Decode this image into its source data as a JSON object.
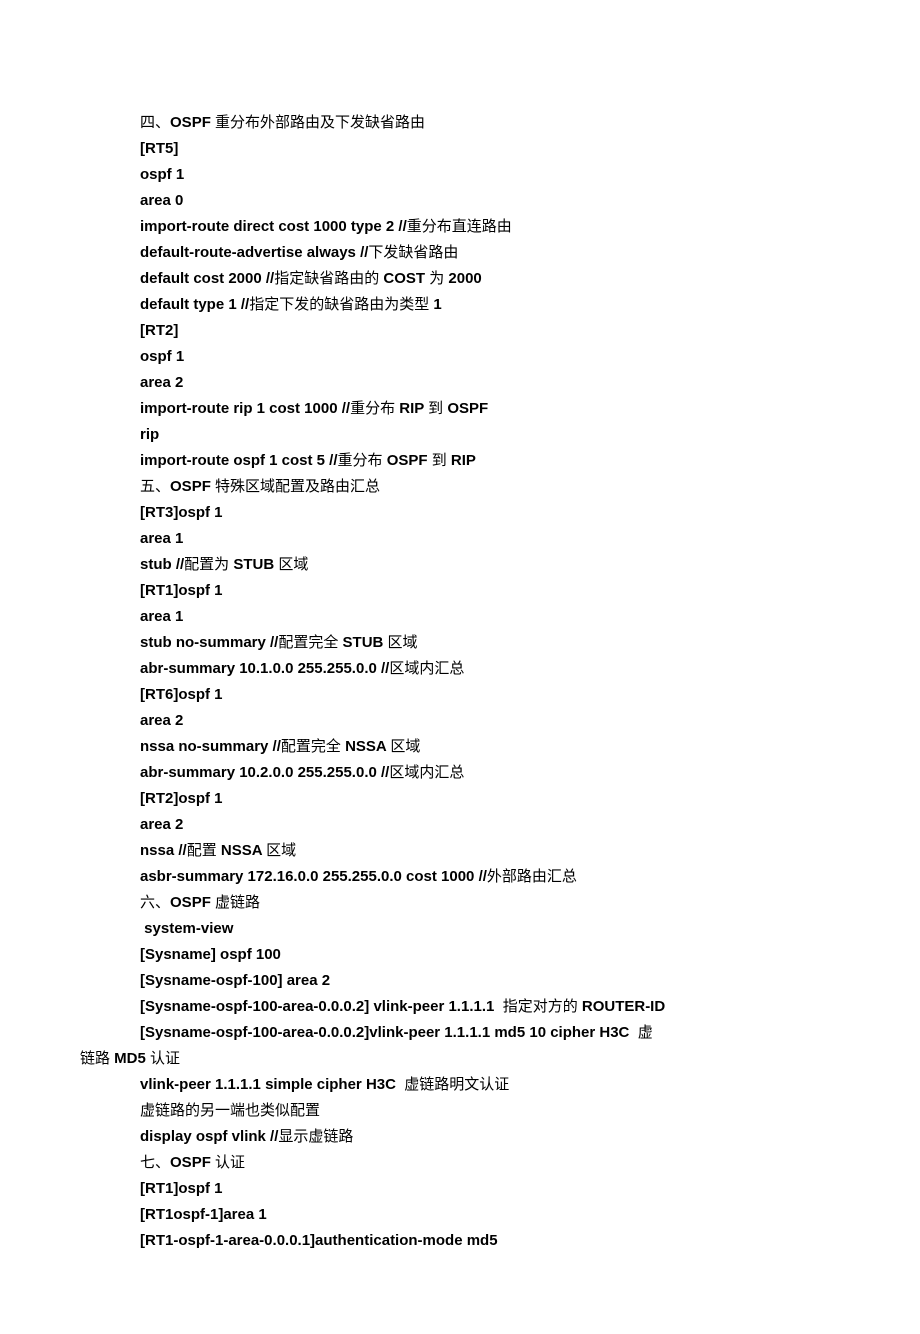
{
  "lines": [
    {
      "id": "l1",
      "segments": [
        {
          "text": "四、",
          "bold": false
        },
        {
          "text": "OSPF ",
          "bold": true
        },
        {
          "text": "重分布外部路由及下发缺省路由",
          "bold": false
        }
      ]
    },
    {
      "id": "l2",
      "segments": [
        {
          "text": "[RT5]",
          "bold": true
        }
      ]
    },
    {
      "id": "l3",
      "segments": [
        {
          "text": "ospf 1",
          "bold": true
        }
      ]
    },
    {
      "id": "l4",
      "segments": [
        {
          "text": "area 0",
          "bold": true
        }
      ]
    },
    {
      "id": "l5",
      "segments": [
        {
          "text": "import-route direct cost 1000 type 2 //",
          "bold": true
        },
        {
          "text": "重分布直连路由",
          "bold": false
        }
      ]
    },
    {
      "id": "l6",
      "segments": [
        {
          "text": "default-route-advertise always //",
          "bold": true
        },
        {
          "text": "下发缺省路由",
          "bold": false
        }
      ]
    },
    {
      "id": "l7",
      "segments": [
        {
          "text": "default cost 2000 //",
          "bold": true
        },
        {
          "text": "指定缺省路由的 ",
          "bold": false
        },
        {
          "text": "COST ",
          "bold": true
        },
        {
          "text": "为 ",
          "bold": false
        },
        {
          "text": "2000",
          "bold": true
        }
      ]
    },
    {
      "id": "l8",
      "segments": [
        {
          "text": "default type 1 //",
          "bold": true
        },
        {
          "text": "指定下发的缺省路由为类型 ",
          "bold": false
        },
        {
          "text": "1",
          "bold": true
        }
      ]
    },
    {
      "id": "l9",
      "segments": [
        {
          "text": "[RT2]",
          "bold": true
        }
      ]
    },
    {
      "id": "l10",
      "segments": [
        {
          "text": "ospf 1",
          "bold": true
        }
      ]
    },
    {
      "id": "l11",
      "segments": [
        {
          "text": "area 2",
          "bold": true
        }
      ]
    },
    {
      "id": "l12",
      "segments": [
        {
          "text": "import-route rip 1 cost 1000 //",
          "bold": true
        },
        {
          "text": "重分布 ",
          "bold": false
        },
        {
          "text": "RIP ",
          "bold": true
        },
        {
          "text": "到 ",
          "bold": false
        },
        {
          "text": "OSPF",
          "bold": true
        }
      ]
    },
    {
      "id": "l13",
      "segments": [
        {
          "text": "rip",
          "bold": true
        }
      ]
    },
    {
      "id": "l14",
      "segments": [
        {
          "text": "import-route ospf 1 cost 5 //",
          "bold": true
        },
        {
          "text": "重分布 ",
          "bold": false
        },
        {
          "text": "OSPF ",
          "bold": true
        },
        {
          "text": "到 ",
          "bold": false
        },
        {
          "text": "RIP",
          "bold": true
        }
      ]
    },
    {
      "id": "l15",
      "segments": [
        {
          "text": "五、",
          "bold": false
        },
        {
          "text": "OSPF ",
          "bold": true
        },
        {
          "text": "特殊区域配置及路由汇总",
          "bold": false
        }
      ]
    },
    {
      "id": "l16",
      "segments": [
        {
          "text": "[RT3]ospf 1",
          "bold": true
        }
      ]
    },
    {
      "id": "l17",
      "segments": [
        {
          "text": "area 1",
          "bold": true
        }
      ]
    },
    {
      "id": "l18",
      "segments": [
        {
          "text": "stub //",
          "bold": true
        },
        {
          "text": "配置为 ",
          "bold": false
        },
        {
          "text": "STUB ",
          "bold": true
        },
        {
          "text": "区域",
          "bold": false
        }
      ]
    },
    {
      "id": "l19",
      "segments": [
        {
          "text": "[RT1]ospf 1",
          "bold": true
        }
      ]
    },
    {
      "id": "l20",
      "segments": [
        {
          "text": "area 1",
          "bold": true
        }
      ]
    },
    {
      "id": "l21",
      "segments": [
        {
          "text": "stub no-summary //",
          "bold": true
        },
        {
          "text": "配置完全 ",
          "bold": false
        },
        {
          "text": "STUB ",
          "bold": true
        },
        {
          "text": "区域",
          "bold": false
        }
      ]
    },
    {
      "id": "l22",
      "segments": [
        {
          "text": "abr-summary 10.1.0.0 255.255.0.0 //",
          "bold": true
        },
        {
          "text": "区域内汇总",
          "bold": false
        }
      ]
    },
    {
      "id": "l23",
      "segments": [
        {
          "text": "[RT6]ospf 1",
          "bold": true
        }
      ]
    },
    {
      "id": "l24",
      "segments": [
        {
          "text": "area 2",
          "bold": true
        }
      ]
    },
    {
      "id": "l25",
      "segments": [
        {
          "text": "nssa no-summary //",
          "bold": true
        },
        {
          "text": "配置完全 ",
          "bold": false
        },
        {
          "text": "NSSA ",
          "bold": true
        },
        {
          "text": "区域",
          "bold": false
        }
      ]
    },
    {
      "id": "l26",
      "segments": [
        {
          "text": "abr-summary 10.2.0.0 255.255.0.0 //",
          "bold": true
        },
        {
          "text": "区域内汇总",
          "bold": false
        }
      ]
    },
    {
      "id": "l27",
      "segments": [
        {
          "text": "[RT2]ospf 1",
          "bold": true
        }
      ]
    },
    {
      "id": "l28",
      "segments": [
        {
          "text": "area 2",
          "bold": true
        }
      ]
    },
    {
      "id": "l29",
      "segments": [
        {
          "text": "nssa //",
          "bold": true
        },
        {
          "text": "配置 ",
          "bold": false
        },
        {
          "text": "NSSA ",
          "bold": true
        },
        {
          "text": "区域",
          "bold": false
        }
      ]
    },
    {
      "id": "l30",
      "segments": [
        {
          "text": "asbr-summary 172.16.0.0 255.255.0.0 cost 1000 //",
          "bold": true
        },
        {
          "text": "外部路由汇总",
          "bold": false
        }
      ]
    },
    {
      "id": "l31",
      "segments": [
        {
          "text": "六、",
          "bold": false
        },
        {
          "text": "OSPF ",
          "bold": true
        },
        {
          "text": "虚链路",
          "bold": false
        }
      ]
    },
    {
      "id": "l32",
      "segments": [
        {
          "text": " system-view",
          "bold": true
        }
      ]
    },
    {
      "id": "l33",
      "segments": [
        {
          "text": "[Sysname] ospf 100",
          "bold": true
        }
      ]
    },
    {
      "id": "l34",
      "segments": [
        {
          "text": "[Sysname-ospf-100] area 2",
          "bold": true
        }
      ]
    },
    {
      "id": "l35",
      "segments": [
        {
          "text": "[Sysname-ospf-100-area-0.0.0.2] vlink-peer 1.1.1.1  ",
          "bold": true
        },
        {
          "text": "指定对方的 ",
          "bold": false
        },
        {
          "text": "ROUTER-ID",
          "bold": true
        }
      ]
    },
    {
      "id": "l36",
      "segments": [
        {
          "text": "[Sysname-ospf-100-area-0.0.0.2]vlink-peer 1.1.1.1 md5 10 cipher H3C  ",
          "bold": true
        },
        {
          "text": "虚",
          "bold": false
        }
      ]
    },
    {
      "id": "l37",
      "unindent": true,
      "segments": [
        {
          "text": "链路 ",
          "bold": false
        },
        {
          "text": "MD5 ",
          "bold": true
        },
        {
          "text": "认证",
          "bold": false
        }
      ]
    },
    {
      "id": "l38",
      "segments": [
        {
          "text": "vlink-peer 1.1.1.1 simple cipher H3C  ",
          "bold": true
        },
        {
          "text": "虚链路明文认证",
          "bold": false
        }
      ]
    },
    {
      "id": "l39",
      "segments": [
        {
          "text": "虚链路的另一端也类似配置",
          "bold": false
        }
      ]
    },
    {
      "id": "l40",
      "segments": [
        {
          "text": "display ospf vlink //",
          "bold": true
        },
        {
          "text": "显示虚链路",
          "bold": false
        }
      ]
    },
    {
      "id": "l41",
      "segments": [
        {
          "text": "七、",
          "bold": false
        },
        {
          "text": "OSPF ",
          "bold": true
        },
        {
          "text": "认证",
          "bold": false
        }
      ]
    },
    {
      "id": "l42",
      "segments": [
        {
          "text": "[RT1]ospf 1",
          "bold": true
        }
      ]
    },
    {
      "id": "l43",
      "segments": [
        {
          "text": "[RT1ospf-1]area 1",
          "bold": true
        }
      ]
    },
    {
      "id": "l44",
      "segments": [
        {
          "text": "[RT1-ospf-1-area-0.0.0.1]authentication-mode md5",
          "bold": true
        }
      ]
    }
  ]
}
